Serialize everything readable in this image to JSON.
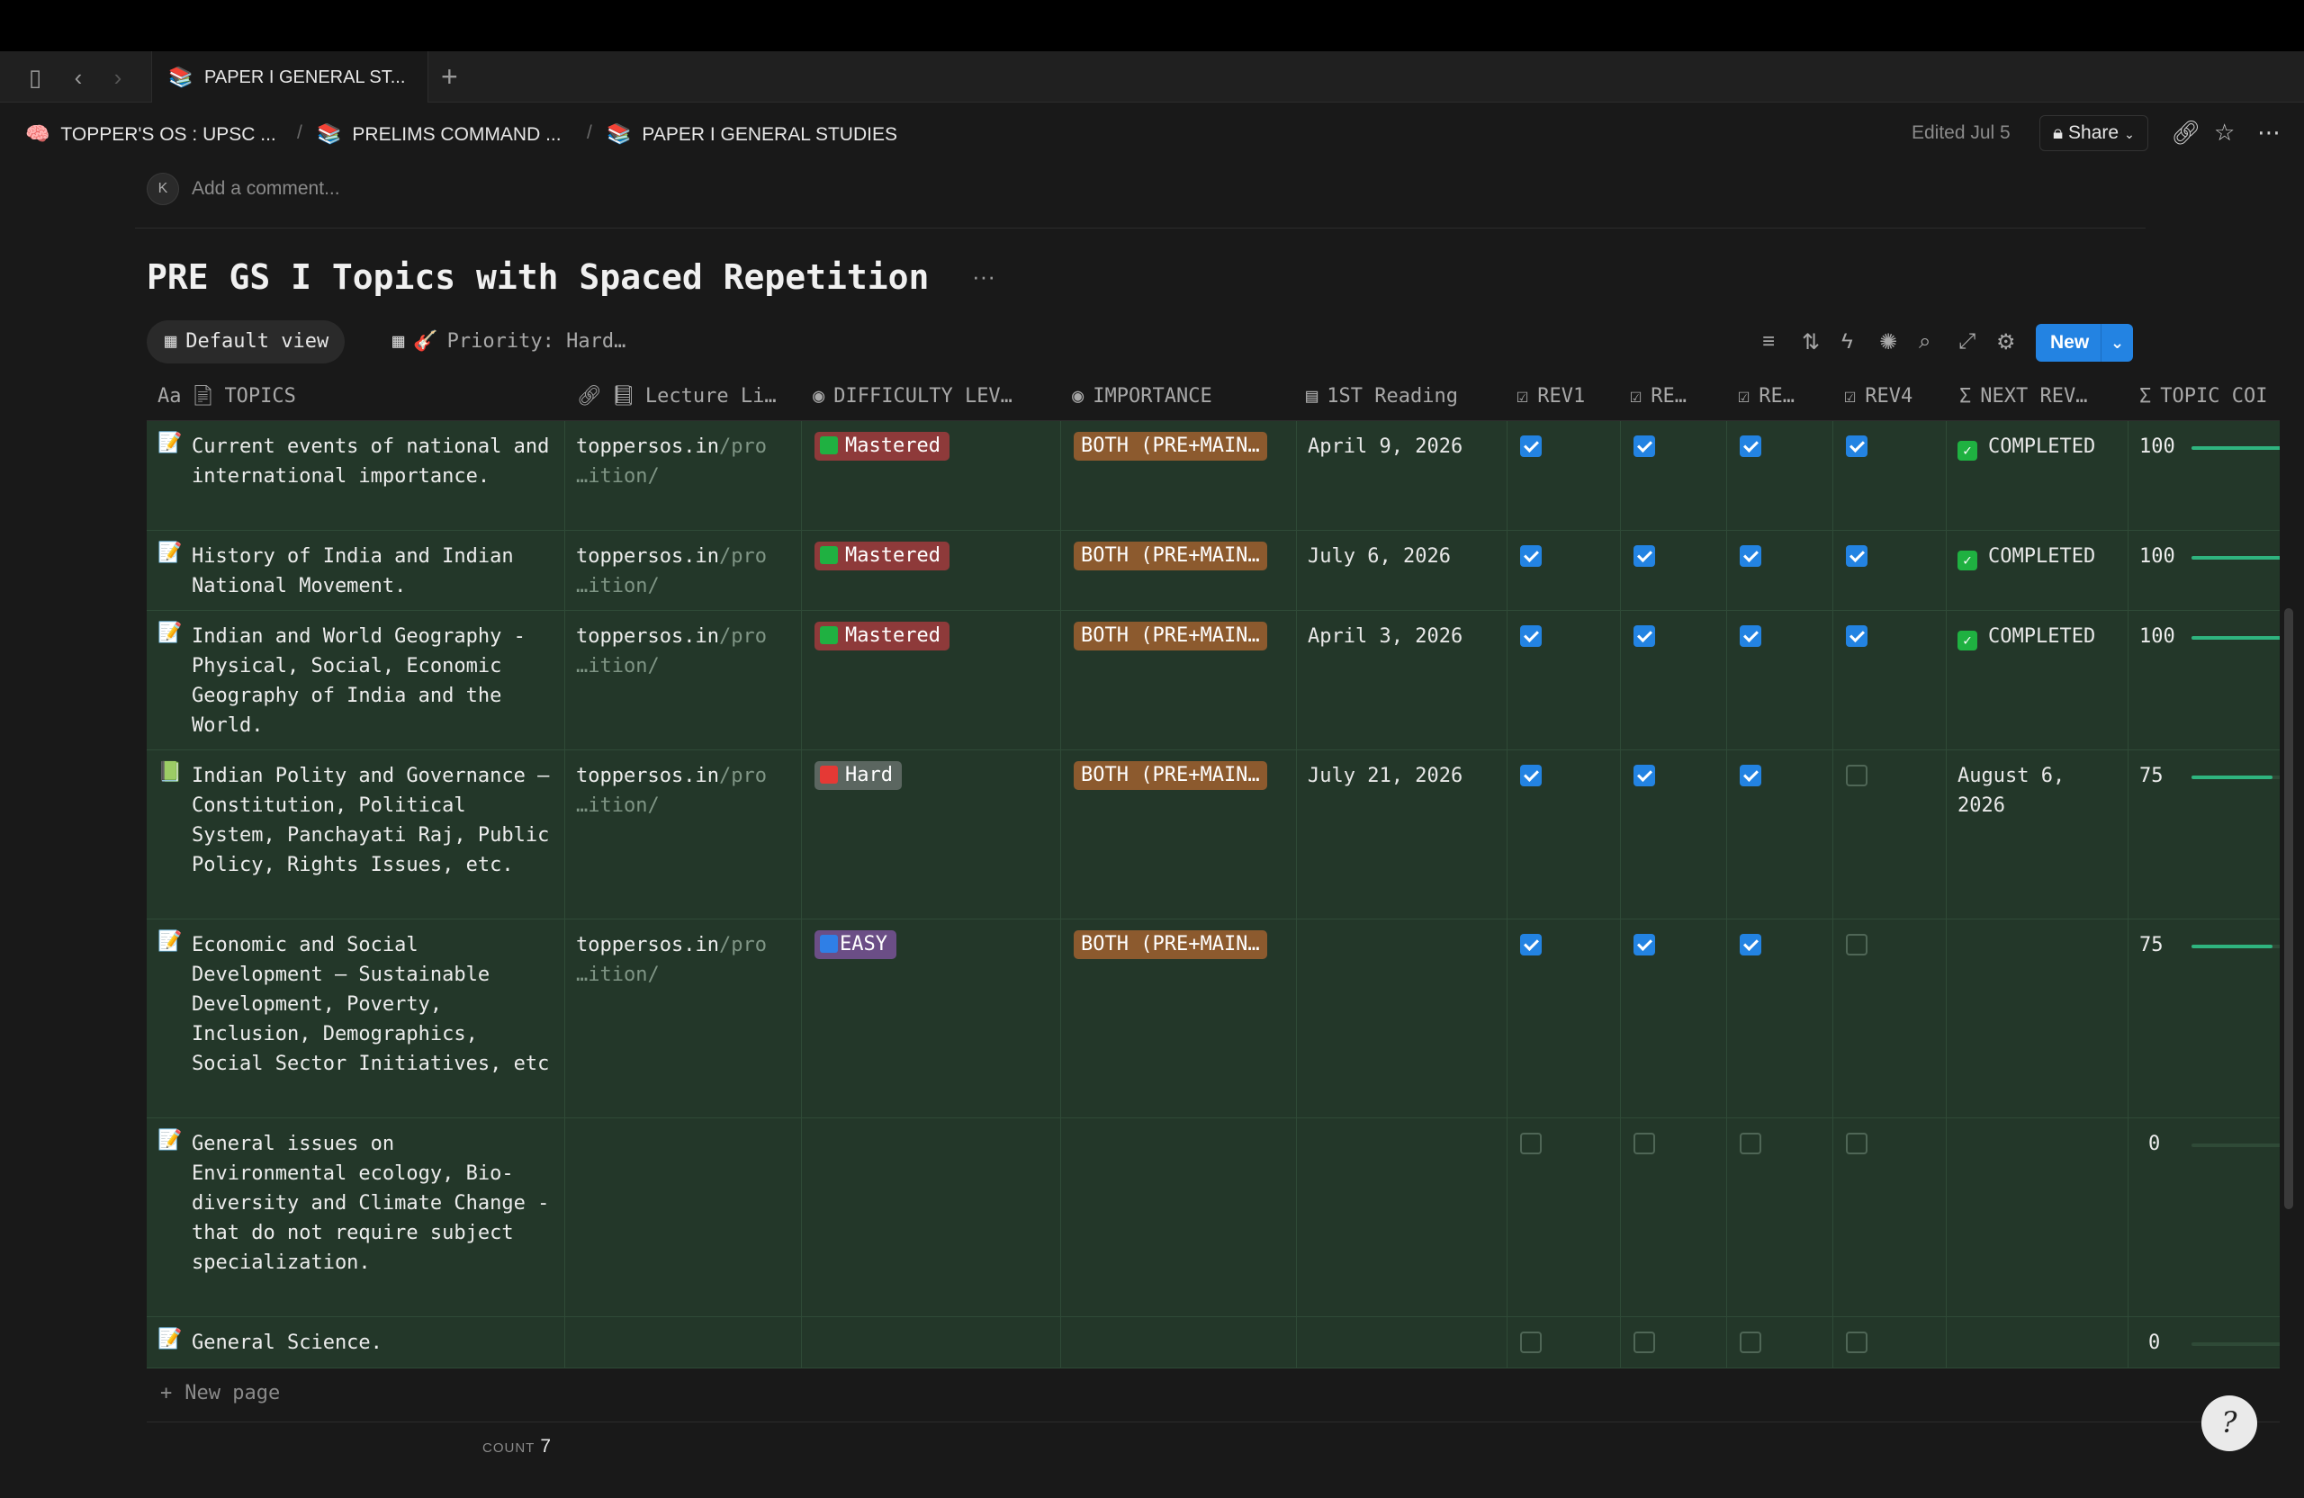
{
  "tab": {
    "icon": "books-icon",
    "icon_glyph": "📚",
    "title": "PAPER I GENERAL ST...",
    "new_glyph": "+"
  },
  "breadcrumb": [
    {
      "icon": "brain-icon",
      "glyph": "🧠",
      "label": "TOPPER'S OS : UPSC ..."
    },
    {
      "icon": "books-icon",
      "glyph": "📚",
      "label": "PRELIMS COMMAND ..."
    },
    {
      "icon": "books-icon",
      "glyph": "📚",
      "label": "PAPER I GENERAL STUDIES"
    }
  ],
  "breadcrumb_sep": "/",
  "header": {
    "edited": "Edited Jul 5",
    "share_label": "Share"
  },
  "comment": {
    "avatar_initial": "K",
    "placeholder": "Add a comment..."
  },
  "database": {
    "title": "PRE GS I Topics with Spaced Repetition",
    "title_more": "···",
    "views": {
      "default": "Default view",
      "priority": "Priority: Hard…"
    },
    "new_label": "New"
  },
  "columns": {
    "topics": "TOPICS",
    "lecture": "Lecture Li…",
    "difficulty": "DIFFICULTY LEV…",
    "importance": "IMPORTANCE",
    "first_reading": "1ST Reading",
    "rev1": "REV1",
    "rev2": "RE…",
    "rev3": "RE…",
    "rev4": "REV4",
    "next_rev": "NEXT REV…",
    "topic_completion": "TOPIC COI"
  },
  "rows": [
    {
      "icon": "📝",
      "topic": "Current events of national and international importance.",
      "link_a": "toppersos.in",
      "link_b": "/pro",
      "link_c": "…ition/",
      "difficulty": "Mastered",
      "diff_kind": "mastered",
      "importance": "BOTH (PRE+MAIN…",
      "first_reading": "April 9, 2026",
      "rev": [
        true,
        true,
        true,
        true
      ],
      "next_rev": "COMPLETED",
      "next_done": true,
      "progress": 100,
      "progress_label": "100"
    },
    {
      "icon": "📝",
      "topic": "History of India and Indian National Movement.",
      "link_a": "toppersos.in",
      "link_b": "/pro",
      "link_c": "…ition/",
      "difficulty": "Mastered",
      "diff_kind": "mastered",
      "importance": "BOTH (PRE+MAIN…",
      "first_reading": "July 6, 2026",
      "rev": [
        true,
        true,
        true,
        true
      ],
      "next_rev": "COMPLETED",
      "next_done": true,
      "progress": 100,
      "progress_label": "100"
    },
    {
      "icon": "📝",
      "topic": "Indian and World Geography - Physical, Social, Economic Geography of India and the World.",
      "link_a": "toppersos.in",
      "link_b": "/pro",
      "link_c": "…ition/",
      "difficulty": "Mastered",
      "diff_kind": "mastered",
      "importance": "BOTH (PRE+MAIN…",
      "first_reading": "April 3, 2026",
      "rev": [
        true,
        true,
        true,
        true
      ],
      "next_rev": "COMPLETED",
      "next_done": true,
      "progress": 100,
      "progress_label": "100"
    },
    {
      "icon": "📗",
      "topic": "Indian Polity and Governance – Constitution, Political System, Panchayati Raj, Public Policy, Rights Issues, etc.",
      "link_a": "toppersos.in",
      "link_b": "/pro",
      "link_c": "…ition/",
      "difficulty": "Hard",
      "diff_kind": "hard",
      "importance": "BOTH (PRE+MAIN…",
      "first_reading": "July 21, 2026",
      "rev": [
        true,
        true,
        true,
        false
      ],
      "next_rev": "August 6, 2026",
      "next_done": false,
      "progress": 75,
      "progress_label": "75"
    },
    {
      "icon": "📝",
      "topic": "Economic and Social Development – Sustainable Development, Poverty, Inclusion, Demographics, Social Sector Initiatives, etc",
      "link_a": "toppersos.in",
      "link_b": "/pro",
      "link_c": "…ition/",
      "difficulty": "EASY",
      "diff_kind": "easy",
      "importance": "BOTH (PRE+MAIN…",
      "first_reading": "",
      "rev": [
        true,
        true,
        true,
        false
      ],
      "next_rev": "",
      "next_done": false,
      "progress": 75,
      "progress_label": "75"
    },
    {
      "icon": "📝",
      "topic": "General issues on Environmental ecology, Bio-diversity and Climate Change - that do not require subject specialization.",
      "link_a": "",
      "link_b": "",
      "link_c": "",
      "difficulty": "",
      "diff_kind": "",
      "importance": "",
      "first_reading": "",
      "rev": [
        false,
        false,
        false,
        false
      ],
      "next_rev": "",
      "next_done": false,
      "progress": 0,
      "progress_label": "0"
    },
    {
      "icon": "📝",
      "topic": "General Science.",
      "link_a": "",
      "link_b": "",
      "link_c": "",
      "difficulty": "",
      "diff_kind": "",
      "importance": "",
      "first_reading": "",
      "rev": [
        false,
        false,
        false,
        false
      ],
      "next_rev": "",
      "next_done": false,
      "progress": 0,
      "progress_label": "0"
    }
  ],
  "footer": {
    "new_page": "New page",
    "count_label": "COUNT",
    "count_value": "7"
  },
  "colors": {
    "accent": "#2383e2",
    "row_bg": "#233729",
    "mastered": "#8e3a3a",
    "importance": "#8c5a2e",
    "progress": "#2fb47f"
  }
}
